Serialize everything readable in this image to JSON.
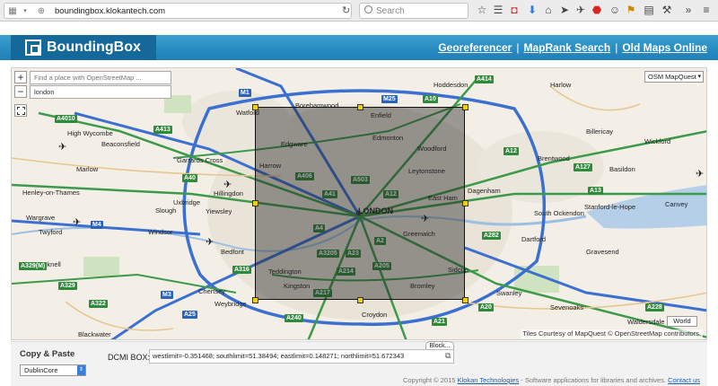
{
  "browser": {
    "url": "boundingbox.klokantech.com",
    "search_placeholder": "Search"
  },
  "header": {
    "logo_text": "BoundingBox",
    "nav": [
      "Georeferencer",
      "MapRank Search",
      "Old Maps Online"
    ],
    "separator": "|"
  },
  "map": {
    "zoom_in": "+",
    "zoom_out": "−",
    "search_placeholder": "Find a place with OpenStreetMap ...",
    "search_value": "london",
    "layer": "OSM MapQuest",
    "world_button": "World",
    "attribution": "Tiles Courtesy of MapQuest © OpenStreetMap contributors.",
    "places": [
      "Watford",
      "Borehamwood",
      "Enfield",
      "Hoddesdon",
      "Harlow",
      "High Wycombe",
      "Beaconsfield",
      "Garrards Cross",
      "Edgware",
      "Edmonton",
      "Woodford",
      "Billericay",
      "Wickford",
      "Marlow",
      "Harrow",
      "Leytonstone",
      "Brentwood",
      "Basildon",
      "Henley-on-Thames",
      "Hillingdon",
      "Uxbridge",
      "Dagenham",
      "Canvey",
      "Wargrave",
      "Twyford",
      "Slough",
      "Yiewsley",
      "LONDON",
      "East Ham",
      "Stanford-le-Hope",
      "Windsor",
      "Greenwich",
      "South Ockendon",
      "Bedfont",
      "Dartford",
      "Gravesend",
      "Teddington",
      "Kingston",
      "Bromley",
      "Sidcup",
      "Chertsey",
      "Weybridge",
      "Croydon",
      "Sevenoaks",
      "Swanley",
      "Blackwater",
      "Bracknell",
      "Waldersdale"
    ],
    "roads": [
      "M1",
      "M25",
      "A10",
      "A414",
      "A4010",
      "A413",
      "A12",
      "A127",
      "A13",
      "A40",
      "A406",
      "A503",
      "A41",
      "A12",
      "A4",
      "A3205",
      "A23",
      "A2",
      "A205",
      "A214",
      "A316",
      "M4",
      "A329(M)",
      "A329",
      "A322",
      "M3",
      "A217",
      "A240",
      "A21",
      "A25",
      "A282",
      "A20",
      "A228"
    ]
  },
  "panel": {
    "title": "Copy & Paste",
    "format": "DublinCore",
    "block_tab": "Block...",
    "box_label": "DCMI BOX:",
    "box_value": "westlimit=-0.351468; southlimit=51.38494; eastlimit=0.148271; northlimit=51.672343",
    "copyright": "Copyright © 2015",
    "company": "Klokan Technologies",
    "tagline": "- Software applications for libraries and archives.",
    "contact": "Contact us"
  }
}
